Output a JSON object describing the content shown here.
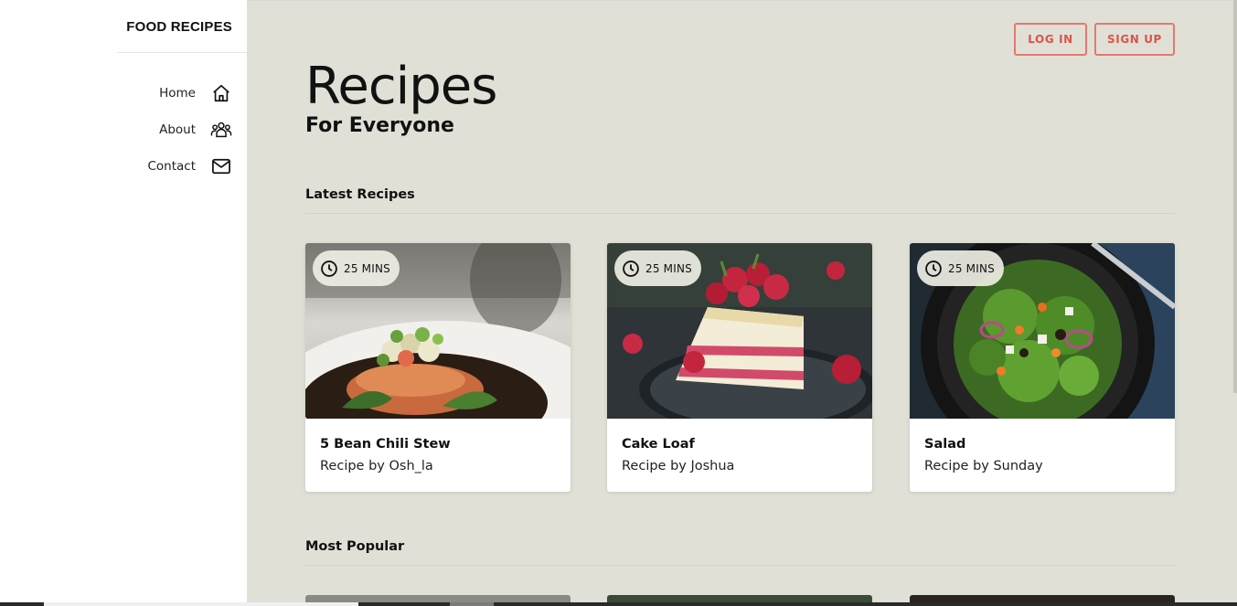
{
  "brand": {
    "title": "FOOD RECIPES"
  },
  "nav": {
    "items": [
      {
        "label": "Home",
        "icon": "home-icon"
      },
      {
        "label": "About",
        "icon": "users-icon"
      },
      {
        "label": "Contact",
        "icon": "mail-icon"
      }
    ]
  },
  "header": {
    "login_label": "LOG IN",
    "signup_label": "SIGN UP"
  },
  "hero": {
    "title": "Recipes",
    "subtitle": "For Everyone"
  },
  "latest": {
    "title": "Latest Recipes",
    "cards": [
      {
        "time": "25 MINS",
        "title": "5 Bean Chili Stew",
        "author": "Recipe by Osh_la",
        "image": "salmon-dish"
      },
      {
        "time": "25 MINS",
        "title": "Cake Loaf",
        "author": "Recipe by Joshua",
        "image": "raspberry-cake"
      },
      {
        "time": "25 MINS",
        "title": "Salad",
        "author": "Recipe by Sunday",
        "image": "green-salad"
      }
    ]
  },
  "popular": {
    "title": "Most Popular"
  },
  "colors": {
    "accent": "#d9544a",
    "background": "#e0e0d6",
    "sidebar": "#ffffff"
  }
}
